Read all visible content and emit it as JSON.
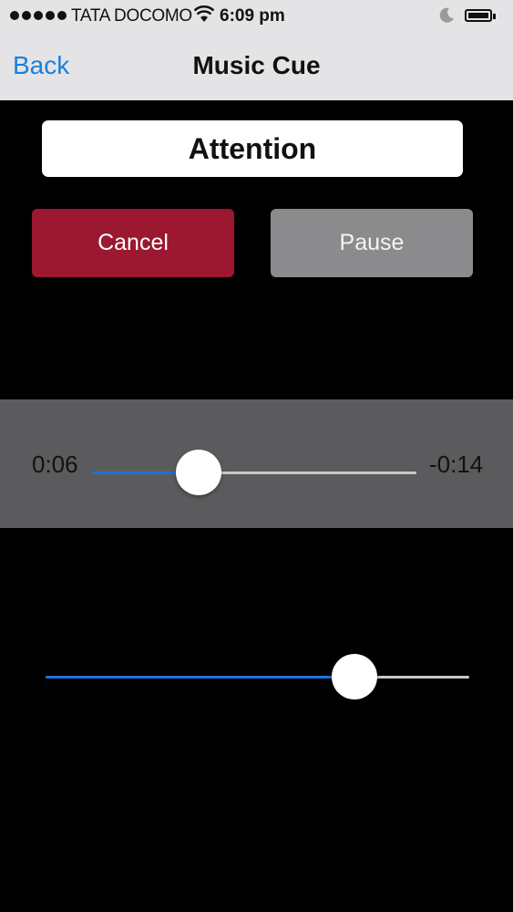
{
  "status_bar": {
    "carrier": "TATA DOCOMO",
    "time": "6:09 pm",
    "signal_icon": "signal-dots-icon",
    "wifi_icon": "wifi-icon",
    "moon_icon": "moon-icon",
    "battery_icon": "battery-icon"
  },
  "nav": {
    "back_label": "Back",
    "title": "Music Cue"
  },
  "cue_name": "Attention",
  "buttons": {
    "cancel_label": "Cancel",
    "pause_label": "Pause"
  },
  "colors": {
    "accent": "#1a7fe0",
    "cancel": "#9c1730",
    "pause": "#8b8b8e",
    "panel": "#5b5b5d"
  },
  "playback": {
    "elapsed": "0:06",
    "remaining": "-0:14",
    "progress_fraction": 0.33
  },
  "volume": {
    "level_fraction": 0.73
  }
}
